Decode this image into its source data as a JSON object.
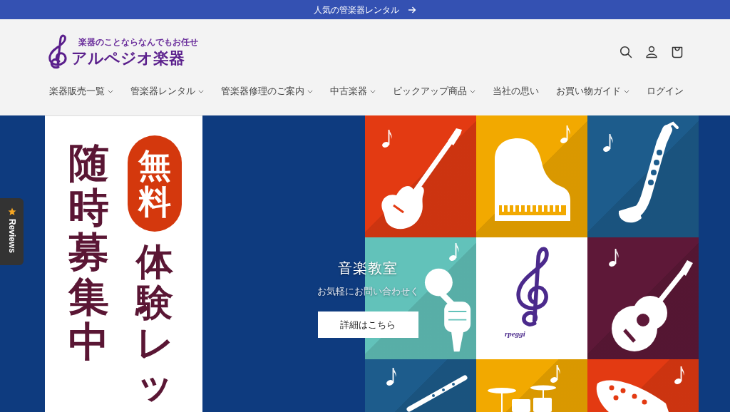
{
  "announcement": {
    "text": "人気の管楽器レンタル"
  },
  "header": {
    "logo": {
      "tagline": "楽器のことならなんでもお任せ",
      "name": "アルペジオ楽器"
    }
  },
  "nav": [
    {
      "label": "楽器販売一覧",
      "kind": "dropdown"
    },
    {
      "label": "管楽器レンタル",
      "kind": "dropdown"
    },
    {
      "label": "管楽器修理のご案内",
      "kind": "dropdown"
    },
    {
      "label": "中古楽器",
      "kind": "dropdown"
    },
    {
      "label": "ピックアップ商品",
      "kind": "dropdown"
    },
    {
      "label": "当社の思い",
      "kind": "link"
    },
    {
      "label": "お買い物ガイド",
      "kind": "dropdown"
    },
    {
      "label": "ログイン",
      "kind": "link"
    }
  ],
  "hero": {
    "banner": {
      "badge": "無料",
      "columns": [
        "体験レッ",
        "随時募集中"
      ]
    },
    "title": "音楽教室",
    "subtitle": "お気軽にお問い合わせく",
    "button": "詳細はこちら",
    "tiles": [
      {
        "kind": "electric-guitar",
        "color": "#e33a12"
      },
      {
        "kind": "piano",
        "color": "#f2a900"
      },
      {
        "kind": "saxophone",
        "color": "#1d5c8c"
      },
      {
        "kind": "microphone",
        "color": "#62c2ba"
      },
      {
        "kind": "logo",
        "color": "#ffffff",
        "text": "rpeggi"
      },
      {
        "kind": "acoustic-guitar",
        "color": "#5e1838"
      },
      {
        "kind": "flute",
        "color": "#1d5c8c"
      },
      {
        "kind": "drums",
        "color": "#f2a900"
      },
      {
        "kind": "ocarina",
        "color": "#e33a12"
      }
    ]
  },
  "reviews_tab": {
    "label": "Reviews"
  }
}
